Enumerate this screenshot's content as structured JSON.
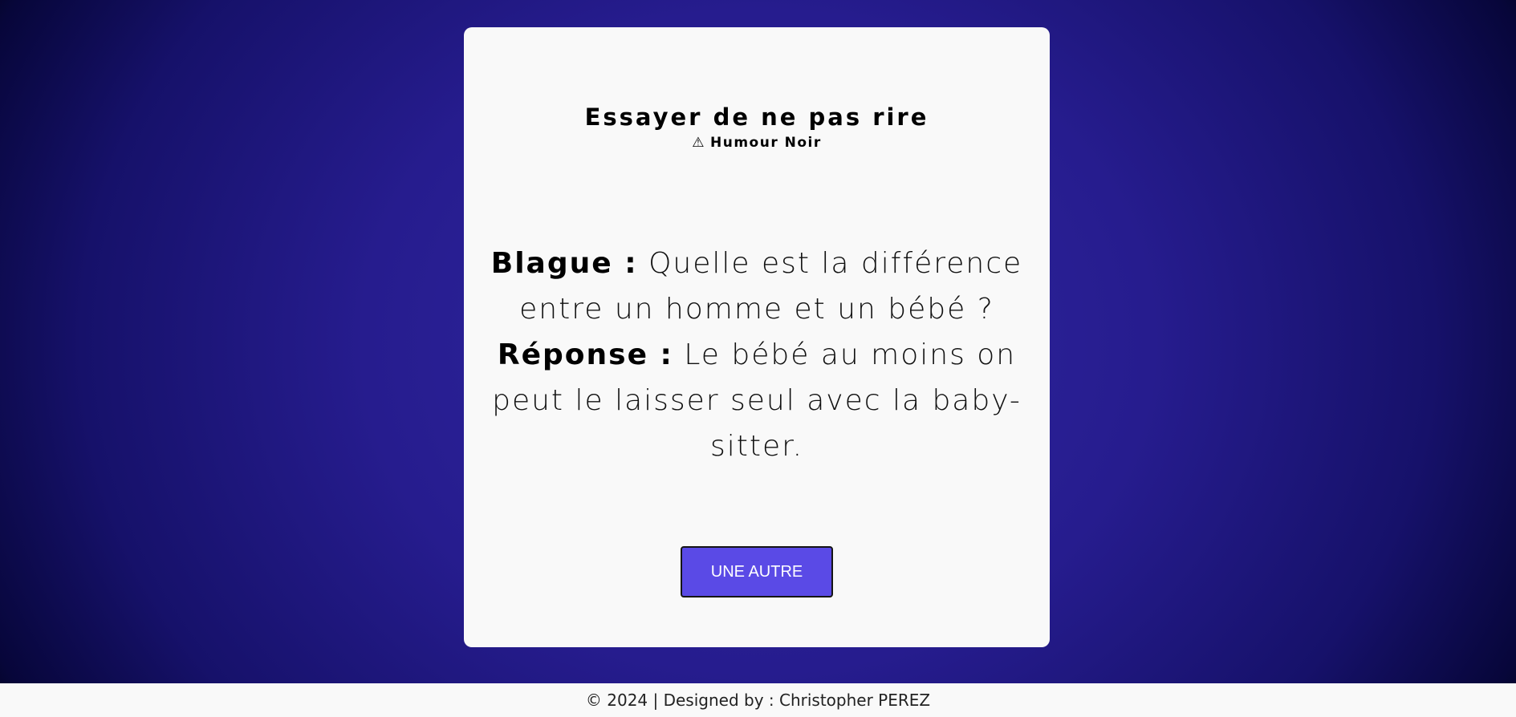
{
  "card": {
    "title": "Essayer de ne pas rire",
    "subtitle_icon": "⚠",
    "subtitle": "Humour Noir",
    "joke": {
      "question_label": "Blague :",
      "question": "Quelle est la différence entre un homme et un bébé ?",
      "answer_label": "Réponse :",
      "answer": "Le bébé au moins on peut le laisser seul avec la baby-sitter."
    },
    "button_label": "UNE AUTRE"
  },
  "footer": {
    "text": "© 2024 | Designed by : Christopher PEREZ"
  },
  "colors": {
    "background_center": "#3128a2",
    "background_edge": "#000000",
    "card_background": "#f9f9f9",
    "button_background": "#5a4ae6",
    "button_text": "#ffffff"
  }
}
